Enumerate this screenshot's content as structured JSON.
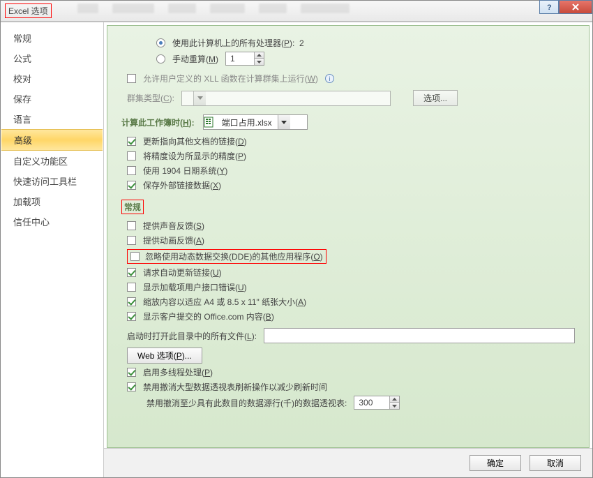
{
  "title": "Excel 选项",
  "sidebar": {
    "items": [
      "常规",
      "公式",
      "校对",
      "保存",
      "语言",
      "高级",
      "自定义功能区",
      "快速访问工具栏",
      "加载项",
      "信任中心"
    ],
    "active_index": 5
  },
  "formulas": {
    "use_all_proc_label": "使用此计算机上的所有处理器(",
    "use_all_proc_hotkey": "P",
    "use_all_proc_suffix": "):",
    "proc_count": "2",
    "manual_label": "手动重算(",
    "manual_hotkey": "M",
    "manual_suffix": ")",
    "manual_value": "1",
    "allow_xll_label": "允许用户定义的 XLL 函数在计算群集上运行(",
    "allow_xll_hotkey": "W",
    "allow_xll_suffix": ")",
    "cluster_type_label": "群集类型(",
    "cluster_type_hotkey": "C",
    "cluster_type_suffix": ":",
    "options_btn": "选项..."
  },
  "workbook": {
    "calc_label": "计算此工作簿时(",
    "calc_hotkey": "H",
    "calc_suffix": ":",
    "selected": "端口占用.xlsx",
    "opts": {
      "update_links_label": "更新指向其他文档的链接(",
      "update_links_hotkey": "D",
      "precision_label": "将精度设为所显示的精度(",
      "precision_hotkey": "P",
      "date1904_label": "使用 1904 日期系统(",
      "date1904_hotkey": "Y",
      "save_ext_label": "保存外部链接数据(",
      "save_ext_hotkey": "X"
    }
  },
  "general": {
    "header": "常规",
    "sound_label": "提供声音反馈(",
    "sound_hotkey": "S",
    "anim_label": "提供动画反馈(",
    "anim_hotkey": "A",
    "ignore_dde_label": "忽略使用动态数据交换(DDE)的其他应用程序(",
    "ignore_dde_hotkey": "O",
    "ask_update_label": "请求自动更新链接(",
    "ask_update_hotkey": "U",
    "addin_err_label": "显示加载项用户接口错误(",
    "addin_err_hotkey": "U",
    "scale_label": "缩放内容以适应 A4 或 8.5 x 11\" 纸张大小(",
    "scale_hotkey": "A",
    "office_label": "显示客户提交的 Office.com 内容(",
    "office_hotkey": "B",
    "startup_label": "启动时打开此目录中的所有文件(",
    "startup_hotkey": "L",
    "startup_suffix": ":",
    "web_opts_btn": "Web 选项(",
    "web_opts_hotkey": "P",
    "web_opts_suffix": ")...",
    "multithread_label": "启用多线程处理(",
    "multithread_hotkey": "P",
    "disable_undo_label": "禁用撤消大型数据透视表刷新操作以减少刷新时间",
    "min_rows_label": "禁用撤消至少具有此数目的数据源行(千)的数据透视表:",
    "min_rows_value": "300"
  },
  "footer": {
    "ok": "确定",
    "cancel": "取消"
  }
}
